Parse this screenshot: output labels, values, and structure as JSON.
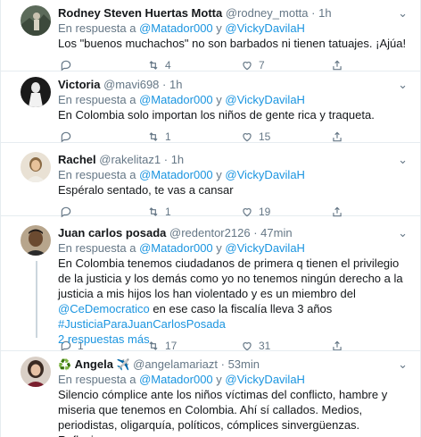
{
  "reply_prefix": "En respuesta a",
  "reply_joiner": "y",
  "mentions": [
    "@Matador000",
    "@VickyDavilaH"
  ],
  "show_more_replies": "2 respuestas más",
  "accent_color": "#1b95e0",
  "tweets": [
    {
      "name": "Rodney Steven Huertas Motta",
      "handle": "@rodney_motta",
      "time": "1h",
      "text": "Los \"buenos muchachos\" no son barbados ni tienen tatuajes. ¡Ajúa!",
      "replies": "",
      "retweets": "4",
      "likes": "7"
    },
    {
      "name": "Victoria",
      "handle": "@mavi698",
      "time": "1h",
      "text": "En Colombia solo importan los niños de gente rica y traqueta.",
      "replies": "",
      "retweets": "1",
      "likes": "15"
    },
    {
      "name": "Rachel",
      "handle": "@rakelitaz1",
      "time": "1h",
      "text": "Espéralo sentado, te vas a cansar",
      "replies": "",
      "retweets": "1",
      "likes": "19"
    },
    {
      "name": "Juan carlos posada",
      "handle": "@redentor2126",
      "time": "47min",
      "text_parts": [
        "En Colombia tenemos ciudadanos de primera q tienen el privilegio de la justicia y los demás como yo no tenemos ningún derecho a la justicia a mis hijos los han violentado y es un miembro del ",
        "@CeDemocratico",
        " en ese caso la fiscalía lleva 3 años ",
        "#JusticiaParaJuanCarlosPosada"
      ],
      "replies": "1",
      "retweets": "17",
      "likes": "31"
    },
    {
      "name": "Angela",
      "name_prefix_icon": "♻️",
      "name_suffix_icon": "✈️",
      "handle": "@angelamariazt",
      "time": "53min",
      "text": "Silencio cómplice ante los niños víctimas del conflicto, hambre y miseria que tenemos en Colombia. Ahí sí callados. Medios, periodistas, oligarquía, políticos, cómplices sinvergüenzas. Reflexionen."
    }
  ]
}
